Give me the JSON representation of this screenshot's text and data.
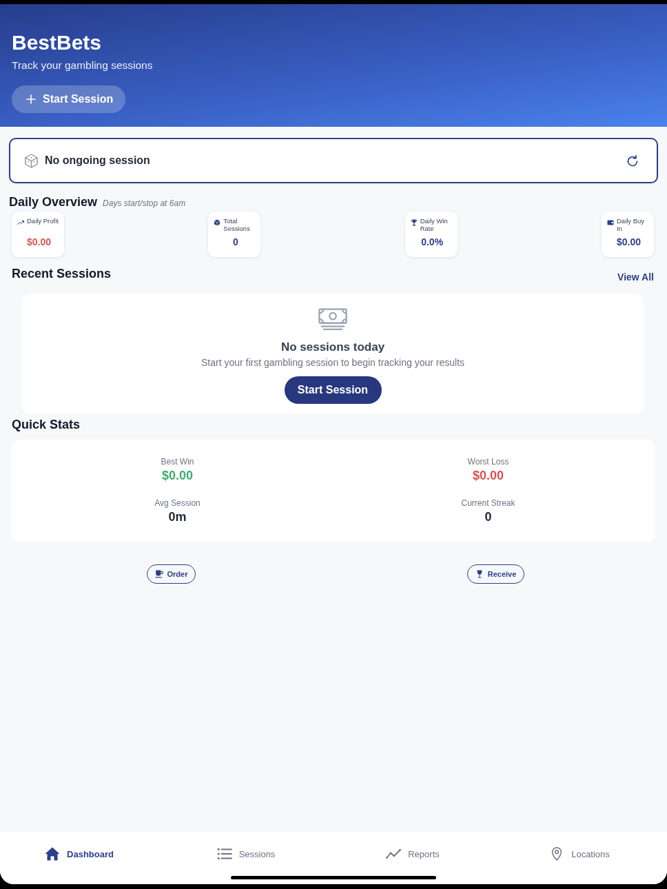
{
  "header": {
    "title": "BestBets",
    "subtitle": "Track your gambling sessions",
    "button": "Start Session"
  },
  "ongoing_session": {
    "status": "No ongoing session"
  },
  "daily_overview": {
    "title": "Daily Overview",
    "note": "Days start/stop at 6am",
    "stats": [
      {
        "label": "Daily Profit",
        "value": "$0.00",
        "color": "#d9534f"
      },
      {
        "label": "Total Sessions",
        "value": "0",
        "color": "#2c3e8c"
      },
      {
        "label": "Daily Win Rate",
        "value": "0.0%",
        "color": "#2c3e8c"
      },
      {
        "label": "Daily Buy In",
        "value": "$0.00",
        "color": "#2c3e8c"
      }
    ]
  },
  "recent_sessions": {
    "title": "Recent Sessions",
    "link": "View All",
    "empty": {
      "title": "No sessions today",
      "message": "Start your first gambling session to begin tracking your results",
      "button": "Start Session"
    }
  },
  "quick_stats": {
    "title": "Quick Stats",
    "stats": [
      {
        "label": "Best Win",
        "value": "$0.00",
        "color": "#3fae6e"
      },
      {
        "label": "Worst Loss",
        "value": "$0.00",
        "color": "#d9534f"
      },
      {
        "label": "Avg Session",
        "value": "0m",
        "color": "#1f2937"
      },
      {
        "label": "Current Streak",
        "value": "0",
        "color": "#1f2937"
      }
    ]
  },
  "actions": [
    "Order",
    "Receive"
  ],
  "tab_bar": [
    {
      "label": "Dashboard",
      "selected": true
    },
    {
      "label": "Sessions",
      "selected": false
    },
    {
      "label": "Reports",
      "selected": false
    },
    {
      "label": "Locations",
      "selected": false
    }
  ]
}
